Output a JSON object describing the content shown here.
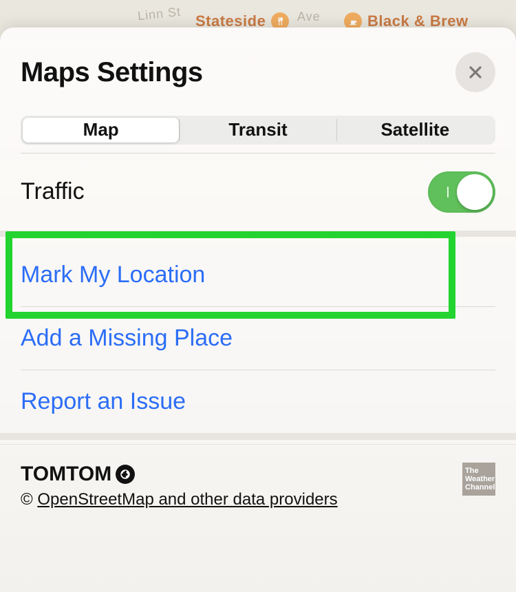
{
  "background_pois": {
    "stateside": "Stateside",
    "blackbrew": "Black & Brew",
    "linn": "Linn St",
    "ave": "Ave"
  },
  "sheet": {
    "title": "Maps Settings"
  },
  "segmented": {
    "items": [
      {
        "label": "Map",
        "active": true
      },
      {
        "label": "Transit",
        "active": false
      },
      {
        "label": "Satellite",
        "active": false
      }
    ]
  },
  "traffic": {
    "label": "Traffic",
    "on": true
  },
  "actions": {
    "mark_location": "Mark My Location",
    "add_missing": "Add a Missing Place",
    "report_issue": "Report an Issue"
  },
  "footer": {
    "tomtom": "TOMTOM",
    "copyright_symbol": "©",
    "osm_link": "OpenStreetMap and other data provid",
    "osm_link_tail": "ers",
    "twc": "The Weather Channel"
  },
  "highlight": {
    "target": "mark-my-location-row"
  },
  "colors": {
    "link": "#2b6df6",
    "toggle_on": "#60c05b",
    "highlight": "#23d32f",
    "poi": "#c5682a"
  }
}
